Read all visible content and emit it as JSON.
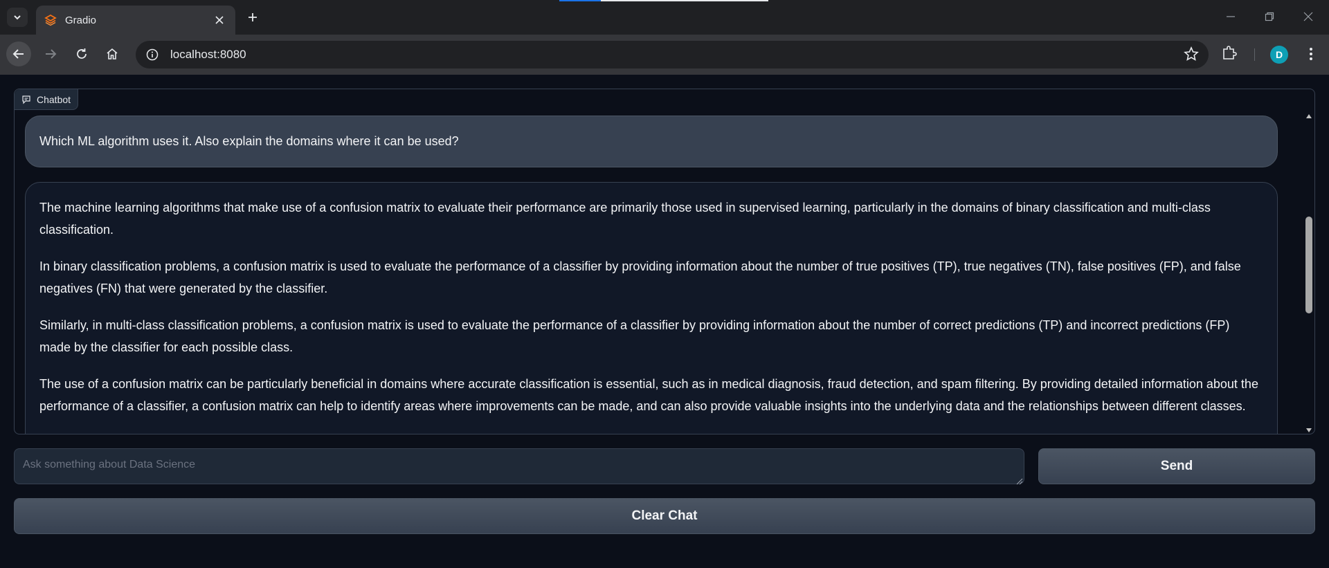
{
  "browser": {
    "tab_title": "Gradio",
    "url": "localhost:8080",
    "profile_initial": "D",
    "accent_color": "#0e9fb5"
  },
  "chatbot": {
    "label": "Chatbot",
    "user_message": "Which ML algorithm uses it. Also explain the domains where it can be used?",
    "bot_paragraphs": [
      "The machine learning algorithms that make use of a confusion matrix to evaluate their performance are primarily those used in supervised learning, particularly in the domains of binary classification and multi-class classification.",
      "In binary classification problems, a confusion matrix is used to evaluate the performance of a classifier by providing information about the number of true positives (TP), true negatives (TN), false positives (FP), and false negatives (FN) that were generated by the classifier.",
      "Similarly, in multi-class classification problems, a confusion matrix is used to evaluate the performance of a classifier by providing information about the number of correct predictions (TP) and incorrect predictions (FP) made by the classifier for each possible class.",
      "The use of a confusion matrix can be particularly beneficial in domains where accurate classification is essential, such as in medical diagnosis, fraud detection, and spam filtering. By providing detailed information about the performance of a classifier, a confusion matrix can help to identify areas where improvements can be made, and can also provide valuable insights into the underlying data and the relationships between different classes."
    ]
  },
  "input": {
    "placeholder": "Ask something about Data Science",
    "value": ""
  },
  "buttons": {
    "send": "Send",
    "clear": "Clear Chat"
  },
  "icons": {
    "tab_list": "chevron-down-icon",
    "favicon": "gradio-logo-icon",
    "close": "close-icon",
    "new_tab": "plus-icon",
    "back": "arrow-left-icon",
    "forward": "arrow-right-icon",
    "reload": "reload-icon",
    "home": "home-icon",
    "site_info": "info-icon",
    "bookmark": "star-icon",
    "extensions": "puzzle-icon",
    "menu": "kebab-menu-icon",
    "chat": "chat-bubble-icon"
  }
}
